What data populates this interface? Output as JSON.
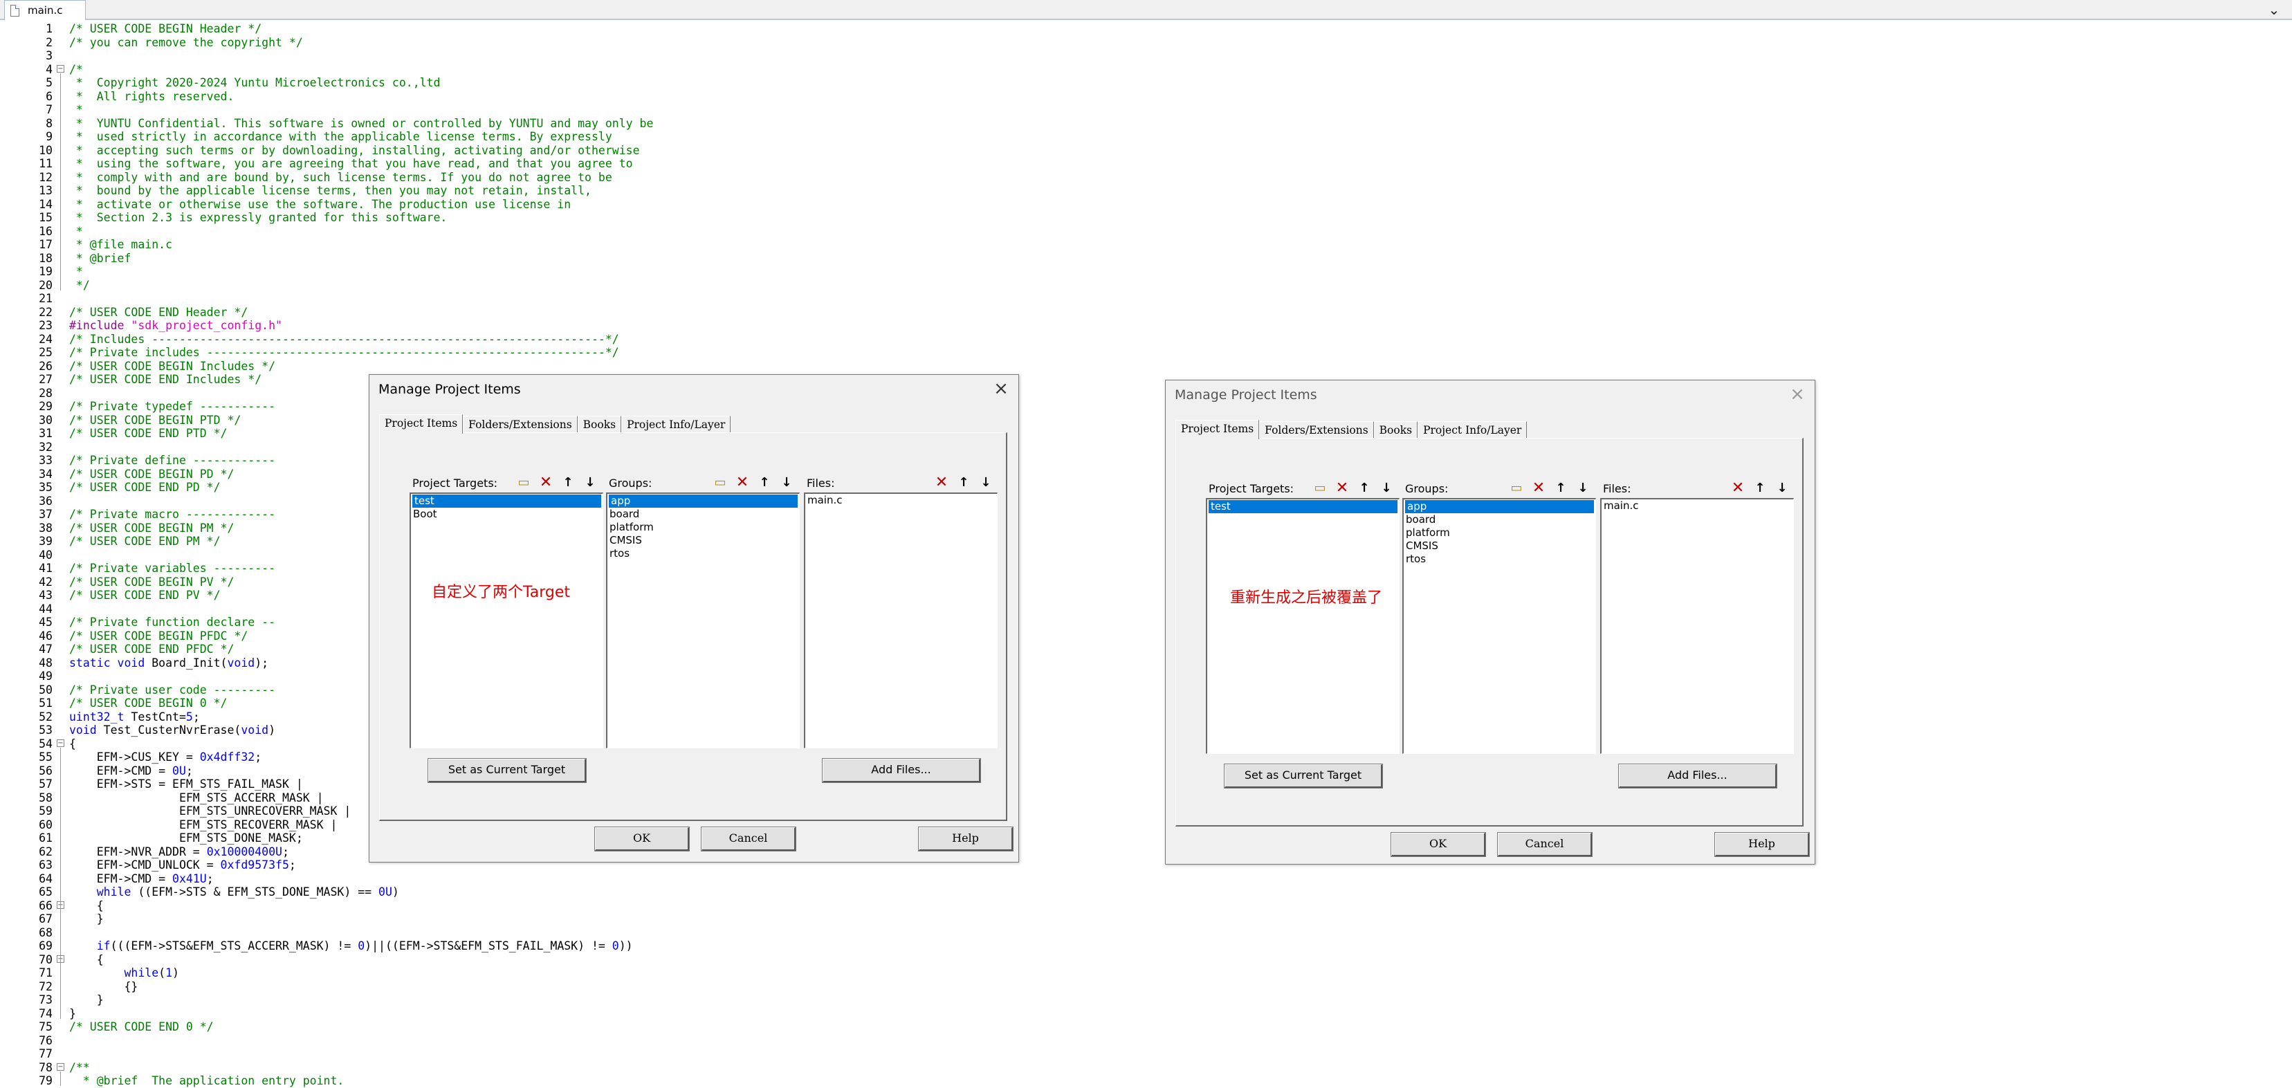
{
  "editor_tab": {
    "label": "main.c",
    "menu_glyph": "⌄"
  },
  "code_lines": [
    {
      "n": "1",
      "segs": [
        {
          "c": "cm",
          "t": "/* USER CODE BEGIN Header */"
        }
      ]
    },
    {
      "n": "2",
      "segs": [
        {
          "c": "cm",
          "t": "/* you can remove the copyright */"
        }
      ]
    },
    {
      "n": "3",
      "segs": []
    },
    {
      "n": "4",
      "fold": "-",
      "segs": [
        {
          "c": "cm",
          "t": "/*"
        }
      ]
    },
    {
      "n": "5",
      "segs": [
        {
          "c": "cm",
          "t": " *  Copyright 2020-2024 Yuntu Microelectronics co.,ltd"
        }
      ]
    },
    {
      "n": "6",
      "segs": [
        {
          "c": "cm",
          "t": " *  All rights reserved."
        }
      ]
    },
    {
      "n": "7",
      "segs": [
        {
          "c": "cm",
          "t": " *"
        }
      ]
    },
    {
      "n": "8",
      "segs": [
        {
          "c": "cm",
          "t": " *  YUNTU Confidential. This software is owned or controlled by YUNTU and may only be"
        }
      ]
    },
    {
      "n": "9",
      "segs": [
        {
          "c": "cm",
          "t": " *  used strictly in accordance with the applicable license terms. By expressly"
        }
      ]
    },
    {
      "n": "10",
      "segs": [
        {
          "c": "cm",
          "t": " *  accepting such terms or by downloading, installing, activating and/or otherwise"
        }
      ]
    },
    {
      "n": "11",
      "segs": [
        {
          "c": "cm",
          "t": " *  using the software, you are agreeing that you have read, and that you agree to"
        }
      ]
    },
    {
      "n": "12",
      "segs": [
        {
          "c": "cm",
          "t": " *  comply with and are bound by, such license terms. If you do not agree to be"
        }
      ]
    },
    {
      "n": "13",
      "segs": [
        {
          "c": "cm",
          "t": " *  bound by the applicable license terms, then you may not retain, install,"
        }
      ]
    },
    {
      "n": "14",
      "segs": [
        {
          "c": "cm",
          "t": " *  activate or otherwise use the software. The production use license in"
        }
      ]
    },
    {
      "n": "15",
      "segs": [
        {
          "c": "cm",
          "t": " *  Section 2.3 is expressly granted for this software."
        }
      ]
    },
    {
      "n": "16",
      "segs": [
        {
          "c": "cm",
          "t": " *"
        }
      ]
    },
    {
      "n": "17",
      "segs": [
        {
          "c": "cm",
          "t": " * @file main.c"
        }
      ]
    },
    {
      "n": "18",
      "segs": [
        {
          "c": "cm",
          "t": " * @brief"
        }
      ]
    },
    {
      "n": "19",
      "segs": [
        {
          "c": "cm",
          "t": " *"
        }
      ]
    },
    {
      "n": "20",
      "segs": [
        {
          "c": "cm",
          "t": " */"
        }
      ]
    },
    {
      "n": "21",
      "segs": []
    },
    {
      "n": "22",
      "segs": [
        {
          "c": "cm",
          "t": "/* USER CODE END Header */"
        }
      ]
    },
    {
      "n": "23",
      "segs": [
        {
          "c": "pp",
          "t": "#include "
        },
        {
          "c": "str",
          "t": "\"sdk_project_config.h\""
        }
      ]
    },
    {
      "n": "24",
      "segs": [
        {
          "c": "cm",
          "t": "/* Includes ------------------------------------------------------------------*/"
        }
      ]
    },
    {
      "n": "25",
      "segs": [
        {
          "c": "cm",
          "t": "/* Private includes ----------------------------------------------------------*/"
        }
      ]
    },
    {
      "n": "26",
      "segs": [
        {
          "c": "cm",
          "t": "/* USER CODE BEGIN Includes */"
        }
      ]
    },
    {
      "n": "27",
      "segs": [
        {
          "c": "cm",
          "t": "/* USER CODE END Includes */"
        }
      ]
    },
    {
      "n": "28",
      "segs": []
    },
    {
      "n": "29",
      "segs": [
        {
          "c": "cm",
          "t": "/* Private typedef -----------"
        }
      ]
    },
    {
      "n": "30",
      "segs": [
        {
          "c": "cm",
          "t": "/* USER CODE BEGIN PTD */"
        }
      ]
    },
    {
      "n": "31",
      "segs": [
        {
          "c": "cm",
          "t": "/* USER CODE END PTD */"
        }
      ]
    },
    {
      "n": "32",
      "segs": []
    },
    {
      "n": "33",
      "segs": [
        {
          "c": "cm",
          "t": "/* Private define ------------"
        }
      ]
    },
    {
      "n": "34",
      "segs": [
        {
          "c": "cm",
          "t": "/* USER CODE BEGIN PD */"
        }
      ]
    },
    {
      "n": "35",
      "segs": [
        {
          "c": "cm",
          "t": "/* USER CODE END PD */"
        }
      ]
    },
    {
      "n": "36",
      "segs": []
    },
    {
      "n": "37",
      "segs": [
        {
          "c": "cm",
          "t": "/* Private macro -------------"
        }
      ]
    },
    {
      "n": "38",
      "segs": [
        {
          "c": "cm",
          "t": "/* USER CODE BEGIN PM */"
        }
      ]
    },
    {
      "n": "39",
      "segs": [
        {
          "c": "cm",
          "t": "/* USER CODE END PM */"
        }
      ]
    },
    {
      "n": "40",
      "segs": []
    },
    {
      "n": "41",
      "segs": [
        {
          "c": "cm",
          "t": "/* Private variables ---------"
        }
      ]
    },
    {
      "n": "42",
      "segs": [
        {
          "c": "cm",
          "t": "/* USER CODE BEGIN PV */"
        }
      ]
    },
    {
      "n": "43",
      "segs": [
        {
          "c": "cm",
          "t": "/* USER CODE END PV */"
        }
      ]
    },
    {
      "n": "44",
      "segs": []
    },
    {
      "n": "45",
      "segs": [
        {
          "c": "cm",
          "t": "/* Private function declare --"
        }
      ]
    },
    {
      "n": "46",
      "segs": [
        {
          "c": "cm",
          "t": "/* USER CODE BEGIN PFDC */"
        }
      ]
    },
    {
      "n": "47",
      "segs": [
        {
          "c": "cm",
          "t": "/* USER CODE END PFDC */"
        }
      ]
    },
    {
      "n": "48",
      "segs": [
        {
          "c": "kw",
          "t": "static void "
        },
        {
          "c": "pl",
          "t": "Board_Init("
        },
        {
          "c": "kw",
          "t": "void"
        },
        {
          "c": "pl",
          "t": ");"
        }
      ]
    },
    {
      "n": "49",
      "segs": []
    },
    {
      "n": "50",
      "segs": [
        {
          "c": "cm",
          "t": "/* Private user code ---------"
        }
      ]
    },
    {
      "n": "51",
      "segs": [
        {
          "c": "cm",
          "t": "/* USER CODE BEGIN 0 */"
        }
      ]
    },
    {
      "n": "52",
      "segs": [
        {
          "c": "kw",
          "t": "uint32_t "
        },
        {
          "c": "pl",
          "t": "TestCnt="
        },
        {
          "c": "num",
          "t": "5"
        },
        {
          "c": "pl",
          "t": ";"
        }
      ]
    },
    {
      "n": "53",
      "segs": [
        {
          "c": "kw",
          "t": "void "
        },
        {
          "c": "pl",
          "t": "Test_CusterNvrErase("
        },
        {
          "c": "kw",
          "t": "void"
        },
        {
          "c": "pl",
          "t": ")"
        }
      ]
    },
    {
      "n": "54",
      "fold": "-",
      "segs": [
        {
          "c": "pl",
          "t": "{"
        }
      ]
    },
    {
      "n": "55",
      "segs": [
        {
          "c": "pl",
          "t": "    EFM->CUS_KEY = "
        },
        {
          "c": "num",
          "t": "0x4dff32"
        },
        {
          "c": "pl",
          "t": ";"
        }
      ]
    },
    {
      "n": "56",
      "segs": [
        {
          "c": "pl",
          "t": "    EFM->CMD = "
        },
        {
          "c": "num",
          "t": "0U"
        },
        {
          "c": "pl",
          "t": ";"
        }
      ]
    },
    {
      "n": "57",
      "segs": [
        {
          "c": "pl",
          "t": "    EFM->STS = EFM_STS_FAIL_MASK |"
        }
      ]
    },
    {
      "n": "58",
      "segs": [
        {
          "c": "pl",
          "t": "                EFM_STS_ACCERR_MASK |"
        }
      ]
    },
    {
      "n": "59",
      "segs": [
        {
          "c": "pl",
          "t": "                EFM_STS_UNRECOVERR_MASK |"
        }
      ]
    },
    {
      "n": "60",
      "segs": [
        {
          "c": "pl",
          "t": "                EFM_STS_RECOVERR_MASK |"
        }
      ]
    },
    {
      "n": "61",
      "segs": [
        {
          "c": "pl",
          "t": "                EFM_STS_DONE_MASK;"
        }
      ]
    },
    {
      "n": "62",
      "segs": [
        {
          "c": "pl",
          "t": "    EFM->NVR_ADDR = "
        },
        {
          "c": "num",
          "t": "0x10000400U"
        },
        {
          "c": "pl",
          "t": ";"
        }
      ]
    },
    {
      "n": "63",
      "segs": [
        {
          "c": "pl",
          "t": "    EFM->CMD_UNLOCK = "
        },
        {
          "c": "num",
          "t": "0xfd9573f5"
        },
        {
          "c": "pl",
          "t": ";"
        }
      ]
    },
    {
      "n": "64",
      "segs": [
        {
          "c": "pl",
          "t": "    EFM->CMD = "
        },
        {
          "c": "num",
          "t": "0x41U"
        },
        {
          "c": "pl",
          "t": ";"
        }
      ]
    },
    {
      "n": "65",
      "segs": [
        {
          "c": "kw",
          "t": "    while "
        },
        {
          "c": "pl",
          "t": "((EFM->STS & EFM_STS_DONE_MASK) == "
        },
        {
          "c": "num",
          "t": "0U"
        },
        {
          "c": "pl",
          "t": ")"
        }
      ]
    },
    {
      "n": "66",
      "fold": "-",
      "segs": [
        {
          "c": "pl",
          "t": "    {"
        }
      ]
    },
    {
      "n": "67",
      "segs": [
        {
          "c": "pl",
          "t": "    }"
        }
      ]
    },
    {
      "n": "68",
      "segs": []
    },
    {
      "n": "69",
      "segs": [
        {
          "c": "kw",
          "t": "    if"
        },
        {
          "c": "pl",
          "t": "(((EFM->STS&EFM_STS_ACCERR_MASK) != "
        },
        {
          "c": "num",
          "t": "0"
        },
        {
          "c": "pl",
          "t": ")||((EFM->STS&EFM_STS_FAIL_MASK) != "
        },
        {
          "c": "num",
          "t": "0"
        },
        {
          "c": "pl",
          "t": "))"
        }
      ]
    },
    {
      "n": "70",
      "fold": "-",
      "segs": [
        {
          "c": "pl",
          "t": "    {"
        }
      ]
    },
    {
      "n": "71",
      "segs": [
        {
          "c": "kw",
          "t": "        while"
        },
        {
          "c": "pl",
          "t": "("
        },
        {
          "c": "num",
          "t": "1"
        },
        {
          "c": "pl",
          "t": ")"
        }
      ]
    },
    {
      "n": "72",
      "segs": [
        {
          "c": "pl",
          "t": "        {}"
        }
      ]
    },
    {
      "n": "73",
      "segs": [
        {
          "c": "pl",
          "t": "    }"
        }
      ]
    },
    {
      "n": "74",
      "segs": [
        {
          "c": "pl",
          "t": "}"
        }
      ]
    },
    {
      "n": "75",
      "segs": [
        {
          "c": "cm",
          "t": "/* USER CODE END 0 */"
        }
      ]
    },
    {
      "n": "76",
      "segs": []
    },
    {
      "n": "77",
      "segs": []
    },
    {
      "n": "78",
      "fold": "-",
      "segs": [
        {
          "c": "cm",
          "t": "/**"
        }
      ]
    },
    {
      "n": "79",
      "segs": [
        {
          "c": "cm",
          "t": "  * @brief  The application entry point."
        }
      ]
    }
  ],
  "dialogs": [
    {
      "title": "Manage Project Items",
      "tabs": [
        "Project Items",
        "Folders/Extensions",
        "Books",
        "Project Info/Layer"
      ],
      "targets_label": "Project Targets:",
      "targets": [
        "test",
        "Boot"
      ],
      "groups_label": "Groups:",
      "groups": [
        "app",
        "board",
        "platform",
        "CMSIS",
        "rtos"
      ],
      "files_label": "Files:",
      "files": [
        "main.c"
      ],
      "note": "自定义了两个Target",
      "set_current_label": "Set as Current Target",
      "add_files_label": "Add Files...",
      "ok_label": "OK",
      "cancel_label": "Cancel",
      "help_label": "Help"
    },
    {
      "title": "Manage Project Items",
      "tabs": [
        "Project Items",
        "Folders/Extensions",
        "Books",
        "Project Info/Layer"
      ],
      "targets_label": "Project Targets:",
      "targets": [
        "test"
      ],
      "groups_label": "Groups:",
      "groups": [
        "app",
        "board",
        "platform",
        "CMSIS",
        "rtos"
      ],
      "files_label": "Files:",
      "files": [
        "main.c"
      ],
      "note": "重新生成之后被覆盖了",
      "set_current_label": "Set as Current Target",
      "add_files_label": "Add Files...",
      "ok_label": "OK",
      "cancel_label": "Cancel",
      "help_label": "Help"
    }
  ],
  "icons": {
    "new": "new-folder-icon",
    "delete": "delete-icon",
    "up": "move-up-icon",
    "down": "move-down-icon",
    "close": "close-icon"
  }
}
